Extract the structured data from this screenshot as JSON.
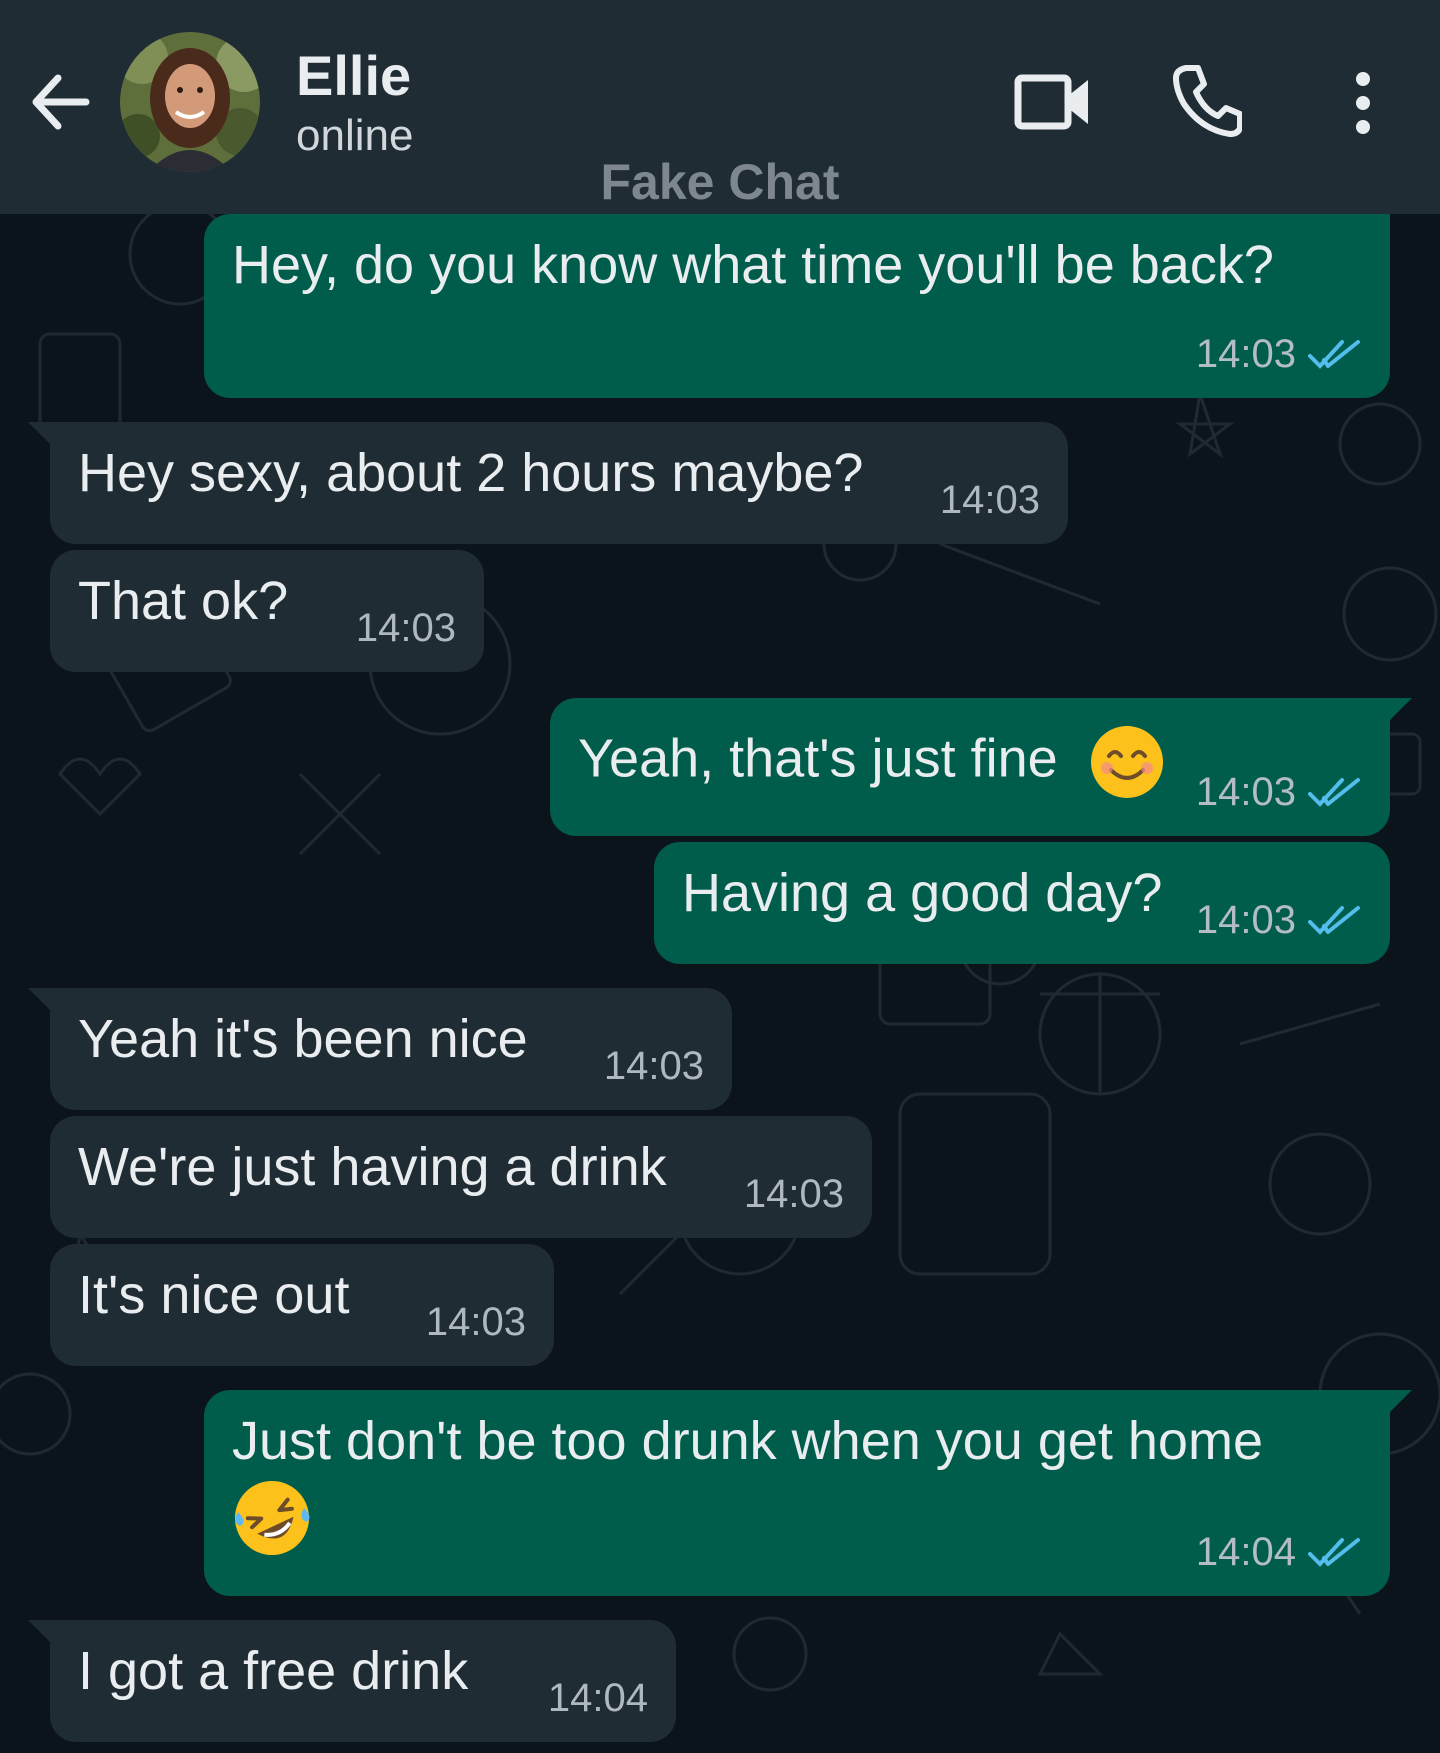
{
  "header": {
    "contact_name": "Ellie",
    "status": "online",
    "watermark": "Fake Chat",
    "icons": [
      "back-arrow-icon",
      "avatar",
      "video-call-icon",
      "phone-icon",
      "more-vertical-icon"
    ]
  },
  "colors": {
    "header_bg": "#1f2c34",
    "chat_bg": "#0b141a",
    "outgoing_bubble": "#005c4b",
    "incoming_bubble": "#202c33",
    "read_ticks": "#53bdeb"
  },
  "messages": [
    {
      "direction": "out",
      "text": "Hey, do you know what time you'll be back?",
      "time": "14:03",
      "status": "read"
    },
    {
      "direction": "in",
      "text": "Hey sexy, about 2 hours maybe?",
      "time": "14:03"
    },
    {
      "direction": "in",
      "text": "That ok?",
      "time": "14:03"
    },
    {
      "direction": "out",
      "text": "Yeah, that's just fine",
      "emoji": "smiling-face-with-smiling-eyes",
      "time": "14:03",
      "status": "read"
    },
    {
      "direction": "out",
      "text": "Having a good day?",
      "time": "14:03",
      "status": "read"
    },
    {
      "direction": "in",
      "text": "Yeah it's been nice",
      "time": "14:03"
    },
    {
      "direction": "in",
      "text": "We're just having a drink",
      "time": "14:03"
    },
    {
      "direction": "in",
      "text": "It's nice out",
      "time": "14:03"
    },
    {
      "direction": "out",
      "text": "Just don't be too drunk when you get home",
      "emoji": "rolling-on-the-floor-laughing",
      "time": "14:04",
      "status": "read"
    },
    {
      "direction": "in",
      "text": "I got a free drink",
      "time": "14:04"
    }
  ]
}
